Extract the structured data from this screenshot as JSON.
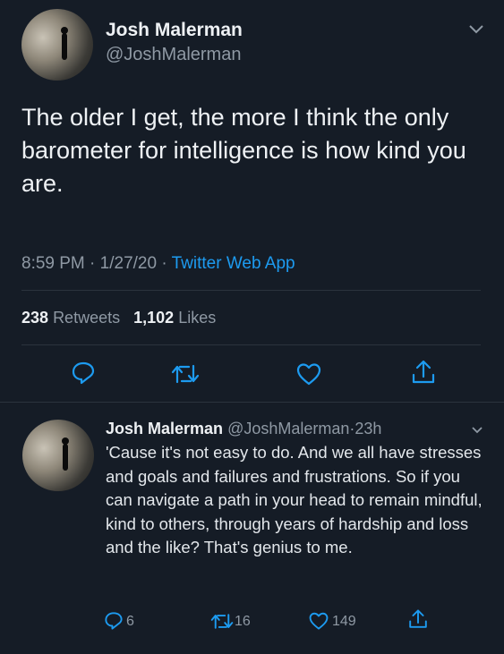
{
  "main_tweet": {
    "author_name": "Josh Malerman",
    "author_handle": "@JoshMalerman",
    "text": "The older I get, the more I think the only barometer for intelligence is how kind you are.",
    "time": "8:59 PM",
    "date": "1/27/20",
    "sep": "·",
    "source": "Twitter Web App",
    "retweets_count": "238",
    "retweets_label": "Retweets",
    "likes_count": "1,102",
    "likes_label": "Likes"
  },
  "reply": {
    "author_name": "Josh Malerman",
    "author_handle": "@JoshMalerman",
    "sep": "·",
    "age": "23h",
    "text": "'Cause it's not easy to do. And we all have stresses and goals and failures and frustrations. So if you can navigate a path in your head to remain mindful, kind to others, through years of hardship and loss and the like? That's genius to me.",
    "reply_count": "6",
    "retweet_count": "16",
    "like_count": "149"
  },
  "icons": [
    "chevron-down-icon",
    "reply-icon",
    "retweet-icon",
    "like-icon",
    "share-icon"
  ],
  "colors": {
    "background": "#151c26",
    "accent": "#1d9bf0",
    "muted": "#8f99a4",
    "text": "#eef1f4"
  }
}
